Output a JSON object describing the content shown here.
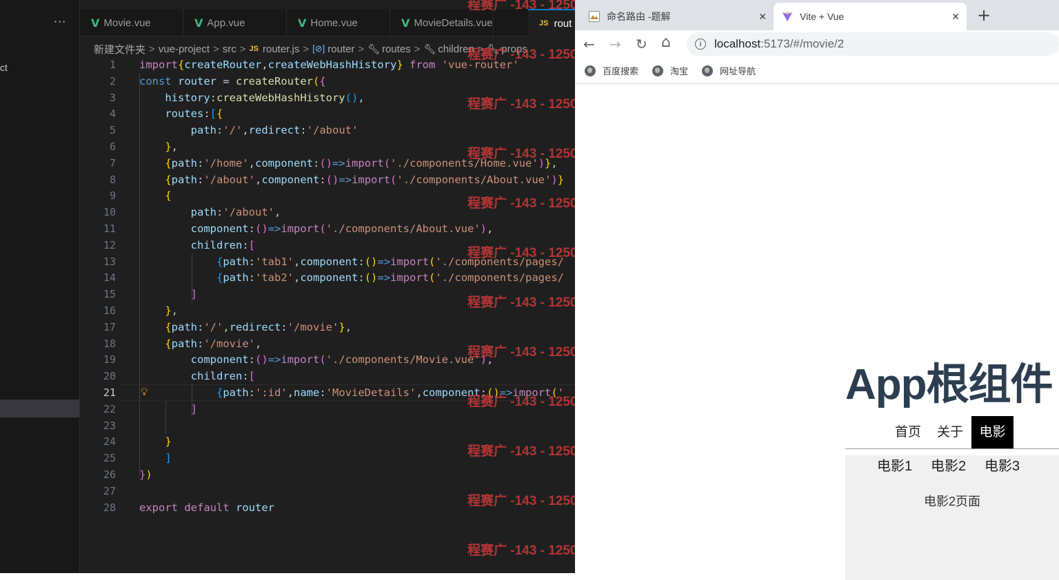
{
  "editor": {
    "explorer_more": "···",
    "explorer_partial_text": "ct",
    "tabs": [
      {
        "label": "Movie.vue",
        "icon": "vue-icon"
      },
      {
        "label": "App.vue",
        "icon": "vue-icon"
      },
      {
        "label": "Home.vue",
        "icon": "vue-icon"
      },
      {
        "label": "MovieDetails.vue",
        "icon": "vue-icon"
      },
      {
        "label": "rout",
        "icon": "js-icon"
      }
    ],
    "js_badge": "JS",
    "vue_badge": "V",
    "breadcrumb": {
      "folder": "新建文件夹",
      "project": "vue-project",
      "src": "src",
      "file": "router.js",
      "router": "router",
      "routes": "routes",
      "children": "children",
      "props": "props",
      "sep": ">"
    },
    "line_numbers": [
      "1",
      "2",
      "3",
      "4",
      "5",
      "6",
      "7",
      "8",
      "9",
      "10",
      "11",
      "12",
      "13",
      "14",
      "15",
      "16",
      "17",
      "18",
      "19",
      "20",
      "21",
      "22",
      "23",
      "24",
      "25",
      "26",
      "27",
      "28"
    ],
    "current_line": "21",
    "watermark": "程赛广 -143 - 1250",
    "colors": {
      "keyword": "#c586c0",
      "declaration": "#569cd6",
      "variable": "#9cdcfe",
      "function": "#dcdcaa",
      "string": "#ce9178",
      "brace_yellow": "#ffd700",
      "brace_pink": "#da70d6",
      "brace_blue": "#179fff",
      "vue_green": "#41b883",
      "js_yellow": "#e8c23b",
      "watermark_red": "#d93a3a"
    }
  },
  "browser": {
    "tab1_title": "命名路由 -题解",
    "tab2_title": "Vite + Vue",
    "close_glyph": "✕",
    "new_tab_glyph": "+",
    "back_glyph": "←",
    "forward_glyph": "→",
    "reload_glyph": "↻",
    "home_glyph": "⌂",
    "info_glyph": "i",
    "url_host": "localhost",
    "url_path": ":5173/#/movie/2",
    "bookmarks": [
      "百度搜索",
      "淘宝",
      "网址导航"
    ]
  },
  "app": {
    "title": "App根组件",
    "nav": [
      "首页",
      "关于",
      "电影"
    ],
    "active_nav": "电影",
    "movies": [
      "电影1",
      "电影2",
      "电影3"
    ],
    "movie_page_text": "电影2页面",
    "colors": {
      "title": "#2c3e50",
      "active_bg": "#000000",
      "panel_bg": "#f0f0f0"
    }
  }
}
